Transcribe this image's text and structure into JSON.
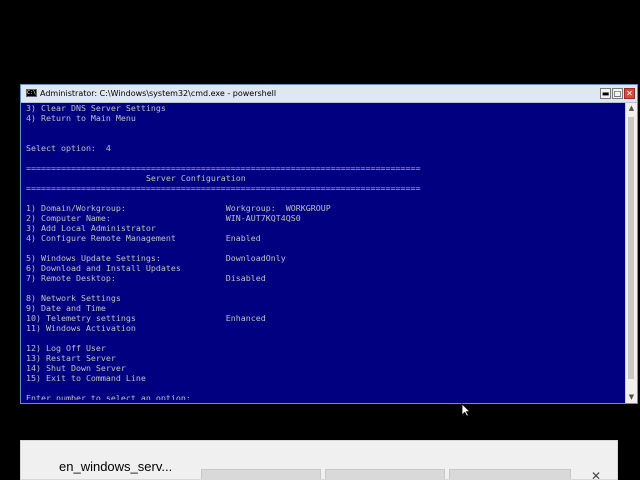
{
  "window": {
    "title": "Administrator: C:\\Windows\\system32\\cmd.exe - powershell",
    "app_icon": "C:\\",
    "controls": {
      "minimize": "▬",
      "maximize": "□",
      "close": "✕"
    }
  },
  "console": {
    "lines": [
      "3) Clear DNS Server Settings",
      "4) Return to Main Menu",
      "",
      "",
      "Select option:  4",
      "",
      "===============================================================================",
      "                        Server Configuration",
      "===============================================================================",
      "",
      "1) Domain/Workgroup:                    Workgroup:  WORKGROUP",
      "2) Computer Name:                       WIN-AUT7KQT4QS0",
      "3) Add Local Administrator",
      "4) Configure Remote Management          Enabled",
      "",
      "5) Windows Update Settings:             DownloadOnly",
      "6) Download and Install Updates",
      "7) Remote Desktop:                      Disabled",
      "",
      "8) Network Settings",
      "9) Date and Time",
      "10) Telemetry settings                  Enhanced",
      "11) Windows Activation",
      "",
      "12) Log Off User",
      "13) Restart Server",
      "14) Shut Down Server",
      "15) Exit to Command Line",
      "",
      "Enter number to select an option:"
    ]
  },
  "scrollbar": {
    "up": "▲",
    "down": "▼"
  },
  "download_bar": {
    "filename": "en_windows_serv...",
    "close": "✕"
  }
}
